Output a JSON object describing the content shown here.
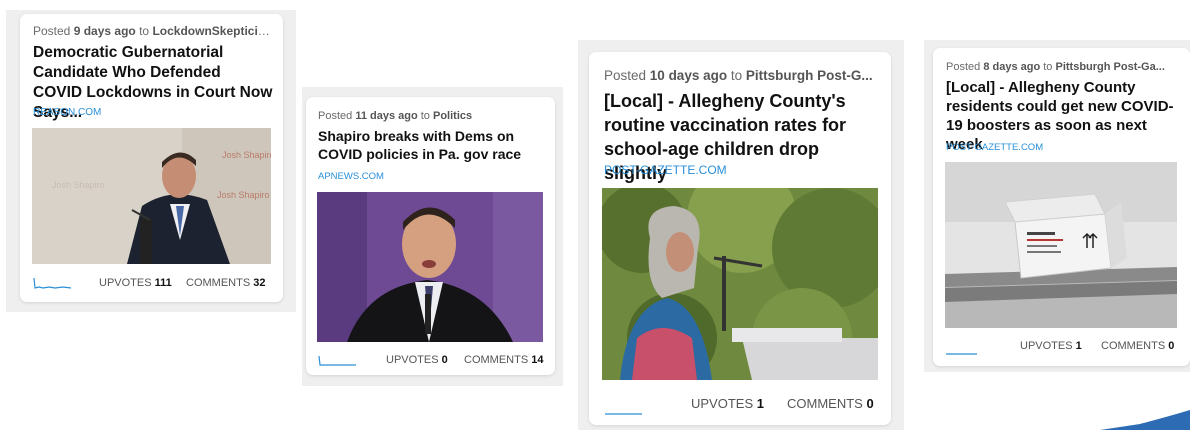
{
  "cards": [
    {
      "posted_prefix": "Posted",
      "age": "9 days ago",
      "to": "to",
      "community": "LockdownSkepticis...",
      "title": "Democratic Gubernatorial Candidate Who Defended COVID Lockdowns in Court Now Says...",
      "domain": "REASON.COM",
      "upvotes_label": "UPVOTES",
      "upvotes": "111",
      "comments_label": "COMMENTS",
      "comments": "32",
      "image_icon": "photo-man-at-podium-icon"
    },
    {
      "posted_prefix": "Posted",
      "age": "11 days ago",
      "to": "to",
      "community": "Politics",
      "title": "Shapiro breaks with Dems on COVID policies in Pa. gov race",
      "domain": "APNEWS.COM",
      "upvotes_label": "UPVOTES",
      "upvotes": "0",
      "comments_label": "COMMENTS",
      "comments": "14",
      "image_icon": "photo-man-speaking-icon"
    },
    {
      "posted_prefix": "Posted",
      "age": "10 days ago",
      "to": "to",
      "community": "Pittsburgh Post-G...",
      "title": "[Local] - Allegheny County's routine vaccination rates for school-age children drop slightly",
      "domain": "POST-GAZETTE.COM",
      "upvotes_label": "UPVOTES",
      "upvotes": "1",
      "comments_label": "COMMENTS",
      "comments": "0",
      "image_icon": "photo-woman-at-lectern-icon"
    },
    {
      "posted_prefix": "Posted",
      "age": "8 days ago",
      "to": "to",
      "community": "Pittsburgh Post-Ga...",
      "title": "[Local] - Allegheny County residents could get new COVID-19 boosters as soon as next week",
      "domain": "POST-GAZETTE.COM",
      "upvotes_label": "UPVOTES",
      "upvotes": "1",
      "comments_label": "COMMENTS",
      "comments": "0",
      "image_icon": "photo-vaccine-box-icon"
    }
  ],
  "colors": {
    "accent": "#2a8fd8",
    "panel": "#efefef",
    "card": "#ffffff"
  }
}
